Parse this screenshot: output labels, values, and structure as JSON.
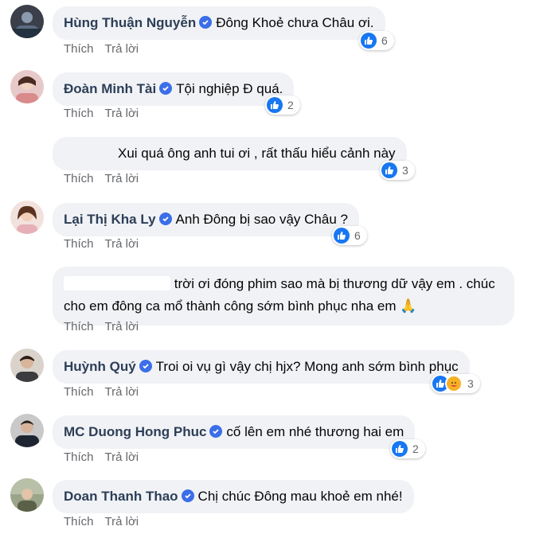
{
  "actions": {
    "like_label": "Thích",
    "reply_label": "Trả lời"
  },
  "accent": "#1877f2",
  "comments": [
    {
      "author": "Hùng Thuận Nguyễn",
      "text": "Đông Khoẻ chưa Châu ơi.",
      "reactions": "6",
      "verified": true
    },
    {
      "author": "Đoàn Minh Tài",
      "text": "Tội nghiệp Đ quá.",
      "reactions": "2",
      "verified": true
    },
    {
      "author": "",
      "text": "Xui quá ông anh tui ơi , rất thấu hiểu cảnh này",
      "reactions": "3",
      "verified": false
    },
    {
      "author": "Lại Thị Kha Ly",
      "text": "Anh Đông bị sao vậy Châu ?",
      "reactions": "6",
      "verified": true
    },
    {
      "author": "",
      "text": "trời ơi đóng phim sao mà bị thương dữ vậy em . chúc cho em đông ca mổ thành công sớm bình phục nha em 🙏",
      "reactions": "",
      "verified": false
    },
    {
      "author": "Huỳnh Quý",
      "text": "Troi oi vụ gì vậy chị hjx? Mong anh sớm bình phục",
      "reactions": "3",
      "verified": true
    },
    {
      "author": "MC Duong Hong Phuc",
      "text": "cố lên em nhé thương hai em",
      "reactions": "2",
      "verified": true
    },
    {
      "author": "Doan Thanh Thao",
      "text": "Chị chúc Đông mau khoẻ em nhé!",
      "reactions": "",
      "verified": true
    }
  ]
}
